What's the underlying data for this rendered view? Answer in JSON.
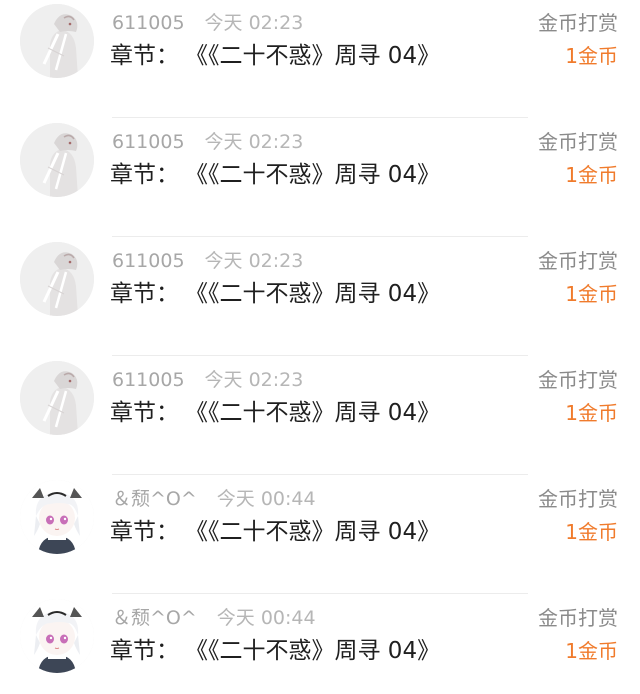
{
  "rewards": [
    {
      "username": "611005",
      "time": "今天 02:23",
      "chapter_label": "章节：",
      "chapter_title": "《《二十不惑》周寻 04》",
      "reward_type": "金币打赏",
      "amount": "1金币",
      "avatar_icon": "avatar-girl-icon"
    },
    {
      "username": "611005",
      "time": "今天 02:23",
      "chapter_label": "章节：",
      "chapter_title": "《《二十不惑》周寻 04》",
      "reward_type": "金币打赏",
      "amount": "1金币",
      "avatar_icon": "avatar-girl-icon"
    },
    {
      "username": "611005",
      "time": "今天 02:23",
      "chapter_label": "章节：",
      "chapter_title": "《《二十不惑》周寻 04》",
      "reward_type": "金币打赏",
      "amount": "1金币",
      "avatar_icon": "avatar-girl-icon"
    },
    {
      "username": "611005",
      "time": "今天 02:23",
      "chapter_label": "章节：",
      "chapter_title": "《《二十不惑》周寻 04》",
      "reward_type": "金币打赏",
      "amount": "1金币",
      "avatar_icon": "avatar-girl-icon"
    },
    {
      "username": "＆颓^O^",
      "time": "今天 00:44",
      "chapter_label": "章节：",
      "chapter_title": "《《二十不惑》周寻 04》",
      "reward_type": "金币打赏",
      "amount": "1金币",
      "avatar_icon": "avatar-anime-icon"
    },
    {
      "username": "＆颓^O^",
      "time": "今天 00:44",
      "chapter_label": "章节：",
      "chapter_title": "《《二十不惑》周寻 04》",
      "reward_type": "金币打赏",
      "amount": "1金币",
      "avatar_icon": "avatar-anime-icon"
    }
  ],
  "colors": {
    "accent": "#f07b2c",
    "primary_text": "#1f1f1f",
    "secondary_text": "#aaaaaa",
    "divider": "#ececec"
  }
}
